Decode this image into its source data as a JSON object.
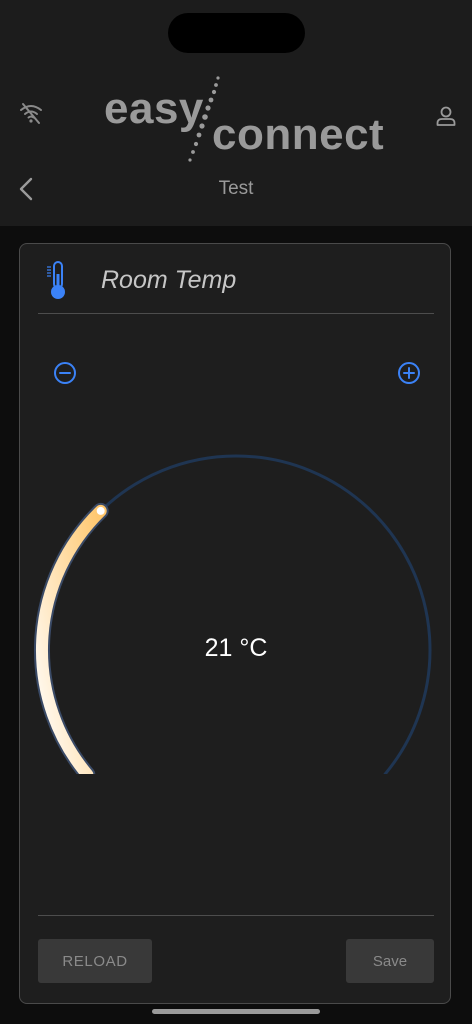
{
  "header": {
    "logo_word_1": "easy",
    "logo_word_2": "connect",
    "title": "Test",
    "wifi_icon": "wifi-off-icon",
    "user_icon": "user-icon",
    "back_icon": "chevron-left-icon"
  },
  "widget": {
    "icon": "thermometer-icon",
    "title": "Room Temp",
    "value": 21,
    "unit": "°C",
    "display": "21 °C",
    "dial_fill_fraction": 0.33,
    "decrement_icon": "minus-circle-icon",
    "increment_icon": "plus-circle-icon",
    "reload_label": "RELOAD",
    "save_label": "Save"
  },
  "colors": {
    "accent": "#3b82f6",
    "dial_track": "#1f3552",
    "dial_fill_start": "#ffffff",
    "dial_fill_end": "#ffc66b",
    "background": "#1e1e1e"
  }
}
